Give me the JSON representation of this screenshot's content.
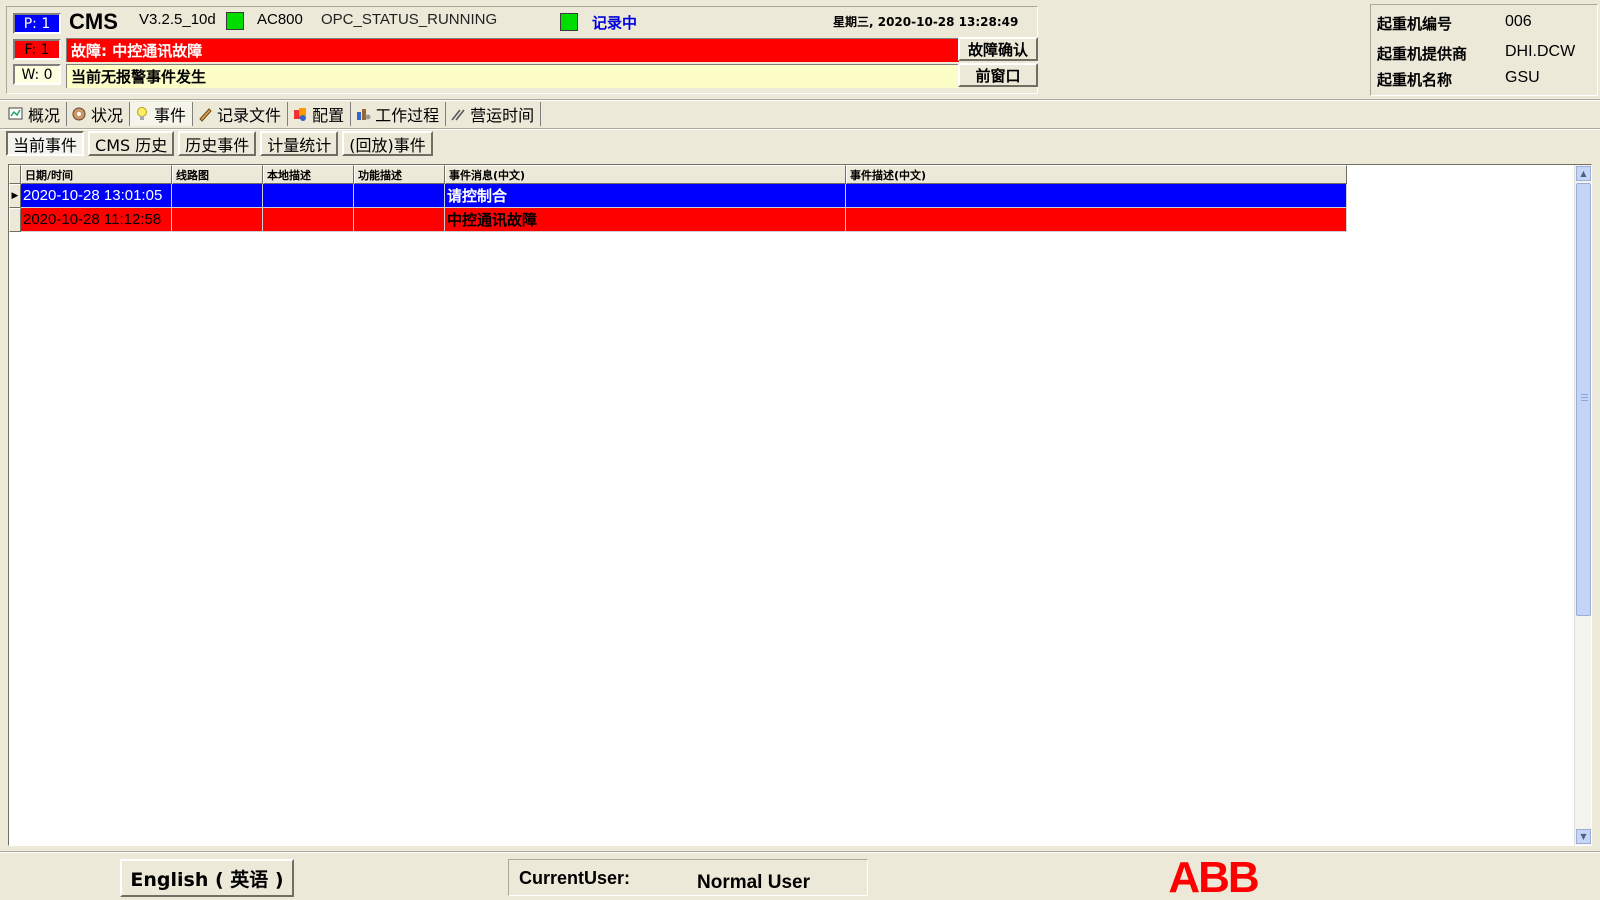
{
  "header": {
    "counters": {
      "p": "P: 1",
      "f": "F: 1",
      "w": "W: 0"
    },
    "app_name": "CMS",
    "version": "V3.2.5_10d",
    "controller": "AC800",
    "opc_status": "OPC_STATUS_RUNNING",
    "recording": "记录中",
    "datetime": "星期三, 2020-10-28  13:28:49",
    "fault_message": "故障: 中控通讯故障",
    "warning_message": "当前无报警事件发生",
    "ack_button": "故障确认",
    "front_window_button": "前窗口"
  },
  "crane_info": [
    {
      "label": "起重机编号",
      "value": "006"
    },
    {
      "label": "起重机提供商",
      "value": "DHI.DCW"
    },
    {
      "label": "起重机名称",
      "value": "GSU"
    }
  ],
  "main_tabs": [
    {
      "label": "概况",
      "icon": "overview-icon"
    },
    {
      "label": "状况",
      "icon": "status-icon"
    },
    {
      "label": "事件",
      "icon": "bulb-icon",
      "active": true
    },
    {
      "label": "记录文件",
      "icon": "record-file-icon"
    },
    {
      "label": "配置",
      "icon": "config-icon"
    },
    {
      "label": "工作过程",
      "icon": "work-process-icon"
    },
    {
      "label": "营运时间",
      "icon": "operating-time-icon"
    }
  ],
  "sub_tabs": [
    {
      "label": "当前事件",
      "active": true
    },
    {
      "label": "CMS 历史"
    },
    {
      "label": "历史事件"
    },
    {
      "label": "计量统计"
    },
    {
      "label": "(回放)事件"
    }
  ],
  "grid": {
    "columns": [
      "日期/时间",
      "线路图",
      "本地描述",
      "功能描述",
      "事件消息(中文)",
      "事件描述(中文)"
    ],
    "rows": [
      {
        "datetime": "2020-10-28 13:01:05",
        "diagram": "",
        "local_desc": "",
        "func_desc": "",
        "message": "请控制合",
        "description": "",
        "color": "#0000ff"
      },
      {
        "datetime": "2020-10-28 11:12:58",
        "diagram": "",
        "local_desc": "",
        "func_desc": "",
        "message": "中控通讯故障",
        "description": "",
        "color": "#ff0000"
      }
    ]
  },
  "footer": {
    "language_button": "English ( 英语 )",
    "current_user_label": "CurrentUser:",
    "current_user_value": "Normal User",
    "logo_text": "ABB",
    "logo_color": "#ff0000"
  }
}
